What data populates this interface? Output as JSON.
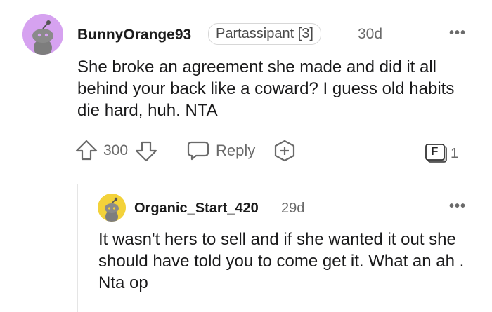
{
  "comment": {
    "username": "BunnyOrange93",
    "flair": "Partassipant [3]",
    "time": "30d",
    "more": "•••",
    "body": "She broke an agreement she made and did it all behind your back like a coward? I guess old habits die hard, huh. NTA",
    "votes": "300",
    "reply_label": "Reply",
    "award_count": "1",
    "award_letter": "F",
    "avatar_color": "#d6a2f0"
  },
  "reply": {
    "username": "Organic_Start_420",
    "time": "29d",
    "more": "•••",
    "body": "It wasn't hers to sell and if she wanted it out she should have told you to come get it. What an ah . Nta op",
    "avatar_color": "#f3d23a"
  },
  "colors": {
    "text": "#1a1a1b",
    "muted": "#6a6a6a",
    "thread_line": "#e5e5e5"
  }
}
